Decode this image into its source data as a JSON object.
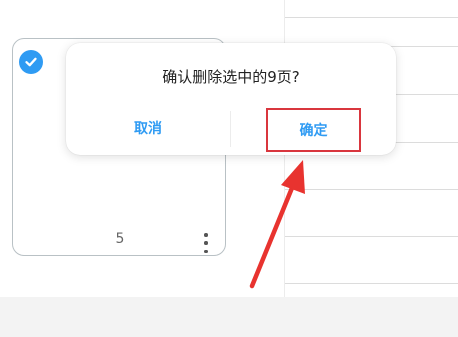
{
  "dialog": {
    "message": "确认删除选中的9页?",
    "cancel_label": "取消",
    "confirm_label": "确定"
  },
  "page_card": {
    "page_number": "5",
    "selected": true
  },
  "colors": {
    "accent": "#2f9bf3",
    "highlight": "#d9363e",
    "card_border": "#b9c1c5"
  },
  "icons": {
    "check": "check-icon",
    "more": "more-vertical-icon",
    "pointer": "red-arrow-annotation"
  }
}
